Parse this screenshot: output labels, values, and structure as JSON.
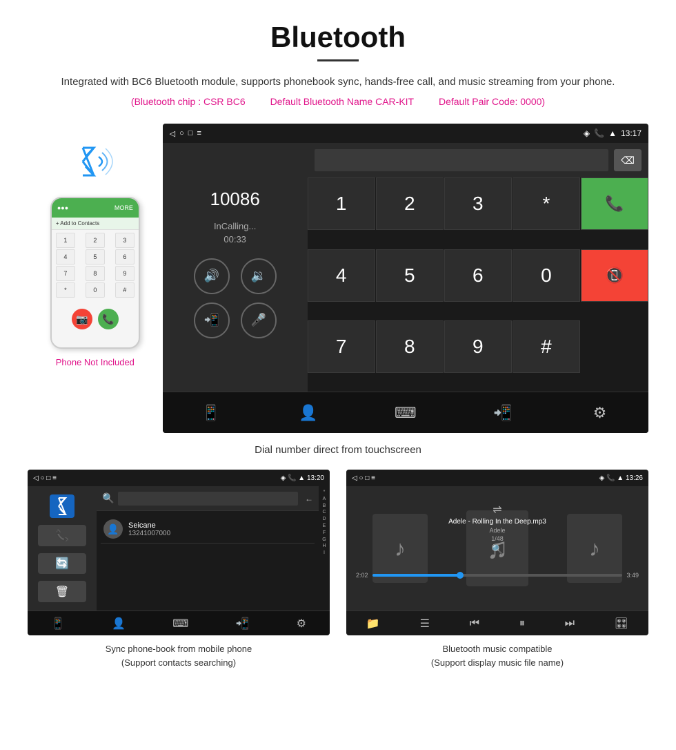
{
  "header": {
    "title": "Bluetooth",
    "description": "Integrated with BC6 Bluetooth module, supports phonebook sync, hands-free call, and music streaming from your phone.",
    "specs": {
      "chip": "(Bluetooth chip : CSR BC6",
      "name": "Default Bluetooth Name CAR-KIT",
      "code": "Default Pair Code: 0000)"
    }
  },
  "dial_screen": {
    "status_bar": {
      "time": "13:17",
      "icons": [
        "location",
        "phone",
        "wifi"
      ]
    },
    "call_number": "10086",
    "call_status": "InCalling...",
    "call_timer": "00:33",
    "keypad": {
      "keys": [
        "1",
        "2",
        "3",
        "*",
        "4",
        "5",
        "6",
        "0",
        "7",
        "8",
        "9",
        "#"
      ]
    },
    "bottom_icons": [
      "call-transfer",
      "contacts",
      "keypad",
      "phone-transfer",
      "settings"
    ]
  },
  "dial_caption": "Dial number direct from touchscreen",
  "contacts_screen": {
    "status_bar": {
      "time": "13:20"
    },
    "contact": {
      "name": "Seicane",
      "phone": "13241007000"
    },
    "alphabet": [
      "*",
      "A",
      "B",
      "C",
      "D",
      "E",
      "F",
      "G",
      "H",
      "I"
    ]
  },
  "music_screen": {
    "status_bar": {
      "time": "13:26"
    },
    "song_title": "Adele - Rolling In the Deep.mp3",
    "artist": "Adele",
    "track_info": "1/48",
    "current_time": "2:02",
    "total_time": "3:49",
    "progress_percent": 35
  },
  "captions": {
    "contacts": "Sync phone-book from mobile phone\n(Support contacts searching)",
    "music": "Bluetooth music compatible\n(Support display music file name)"
  },
  "phone_label": "Phone Not Included"
}
